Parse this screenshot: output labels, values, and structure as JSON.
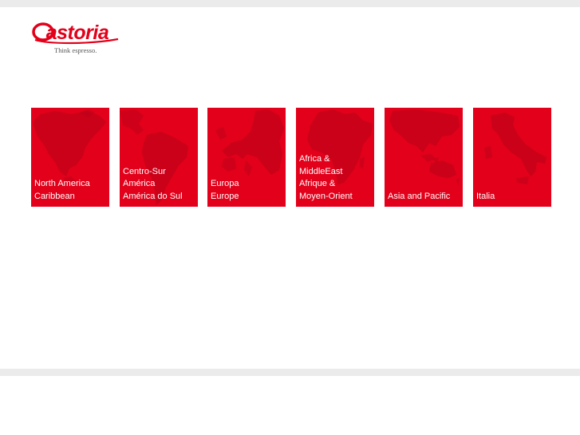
{
  "brand": {
    "logo_text": "astoria",
    "tagline": "Think espresso.",
    "color": "#e2001a"
  },
  "regions": [
    {
      "id": "north-america",
      "lines": [
        "North America",
        "Caribbean"
      ],
      "map_icon": "north-america-map-icon"
    },
    {
      "id": "south-america",
      "lines": [
        "Centro-Sur",
        "América",
        "América do Sul"
      ],
      "map_icon": "south-america-map-icon"
    },
    {
      "id": "europe",
      "lines": [
        "Europa",
        "Europe"
      ],
      "map_icon": "europe-map-icon"
    },
    {
      "id": "africa-middle-east",
      "lines": [
        "Africa &",
        "MiddleEast",
        "Afrique &",
        "Moyen-Orient"
      ],
      "map_icon": "africa-map-icon"
    },
    {
      "id": "asia-pacific",
      "lines": [
        "Asia and Pacific"
      ],
      "map_icon": "asia-pacific-map-icon"
    },
    {
      "id": "italia",
      "lines": [
        "Italia"
      ],
      "map_icon": "italy-map-icon"
    }
  ]
}
